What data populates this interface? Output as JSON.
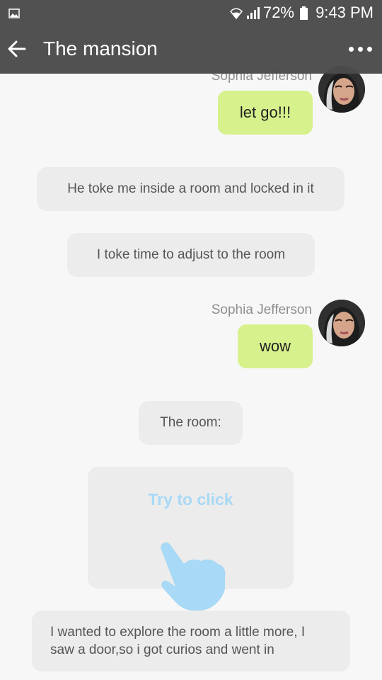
{
  "status_bar": {
    "battery_percent": "72%",
    "time": "9:43 PM"
  },
  "app_bar": {
    "title": "The mansion",
    "back_icon": "arrow-left-icon",
    "more_icon": "more-dots-icon"
  },
  "messages": [
    {
      "type": "user",
      "sender": "Sophia Jefferson",
      "text": "let go!!!"
    },
    {
      "type": "narration",
      "text": "He toke me inside a room and locked in it"
    },
    {
      "type": "narration",
      "text": "I toke time to adjust to the room"
    },
    {
      "type": "user",
      "sender": "Sophia Jefferson",
      "text": "wow"
    },
    {
      "type": "narration",
      "text": "The room:"
    },
    {
      "type": "interactive",
      "text": "Try to click"
    },
    {
      "type": "narration",
      "text": "I wanted to explore the room a little more, I saw a door,so i got curios and went in"
    }
  ],
  "colors": {
    "accent_green": "#d7f18d",
    "try_blue": "#a8d9f6",
    "header": "#4b4b4b"
  }
}
